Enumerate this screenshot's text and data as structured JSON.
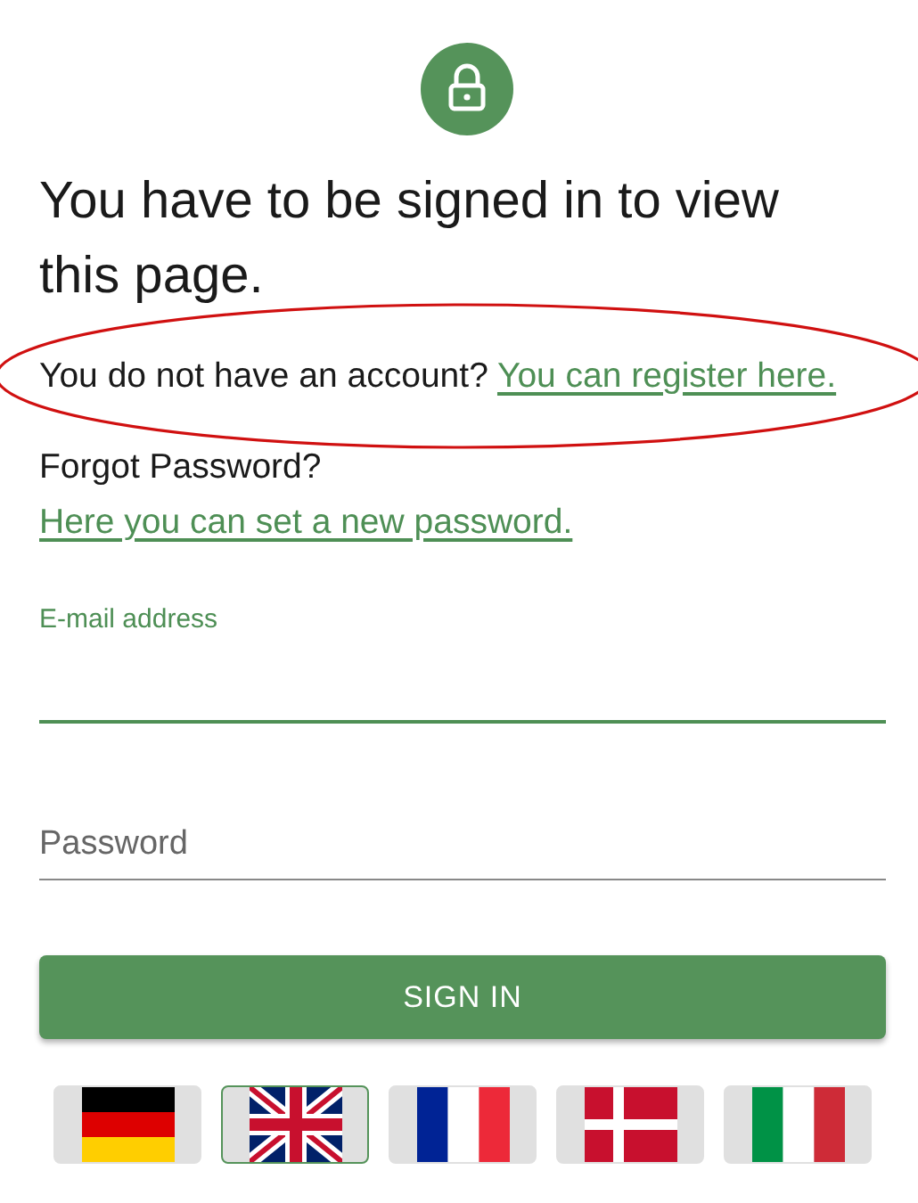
{
  "heading": "You have to be signed in to view this page.",
  "register": {
    "text": "You do not have an account?",
    "link": "You can register here."
  },
  "forgot": {
    "text": "Forgot Password?",
    "link": "Here you can set a new password."
  },
  "fields": [
    {
      "label": "E-mail address",
      "focused": true
    },
    {
      "label": "Password",
      "focused": false
    }
  ],
  "submit": "SIGN IN",
  "languages": [
    {
      "kind": "de",
      "selected": false
    },
    {
      "kind": "gb",
      "selected": true
    },
    {
      "kind": "fr",
      "selected": false
    },
    {
      "kind": "dk",
      "selected": false
    },
    {
      "kind": "it",
      "selected": false
    }
  ]
}
